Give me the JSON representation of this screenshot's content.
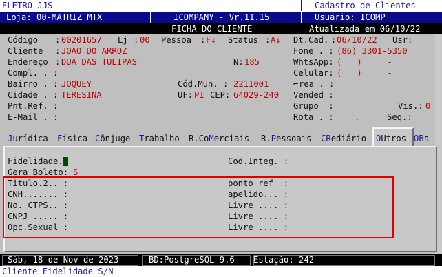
{
  "header": {
    "company": "ELETRO JJS",
    "screen_title": "Cadastro de Clientes",
    "store": "Loja: 00-MATRIZ MTX",
    "system": "ICOMPANY - Vr.11.15",
    "user": "Usuário: ICOMP",
    "form_title": "FICHA DO CLIENTE",
    "updated": "Atualizada em 06/10/22"
  },
  "fields": {
    "codigo_label": "Código",
    "codigo_value": "00201657",
    "lj_label": "Lj",
    "lj_value": "00",
    "pessoa_label": "Pessoa",
    "pessoa_value": "F↓",
    "status_label": "Status",
    "status_value": "A↓",
    "dtcad_label": "Dt.Cad.",
    "dtcad_value": "06/10/22",
    "usr_label": "Usr:",
    "cliente_label": "Cliente",
    "cliente_value": "JOAO DO ARROZ",
    "fone_label": "Fone . :",
    "fone_value": "(86) 3301-5350",
    "endereco_label": "Endereço",
    "endereco_value": "DUA DAS TULIPAS",
    "n_label": "N:",
    "n_value": "185",
    "whats_label": "WhtsApp:",
    "whats_value": "(   )     -",
    "compl_label": "Compl. . :",
    "celular_label": "Celular:",
    "celular_value": "(   )     -",
    "bairro_label": "Bairro . :",
    "bairro_value": "JOQUEY",
    "codmun_label": "Cód.Mun. :",
    "codmun_value": "2211001",
    "area_label": "rea . :",
    "cidade_label": "Cidade . :",
    "cidade_value": "TERESINA",
    "uf_label": "UF:",
    "uf_value": "PI",
    "cep_label": "CEP:",
    "cep_value": "64029-240",
    "vendedor_label": "Vended :",
    "pntref_label": "Pnt.Ref. :",
    "grupo_label": "Grupo  :",
    "vis_label": "Vis.:",
    "vis_value": "0",
    "email_label": "E-Mail . :",
    "rota_label": "Rota . :",
    "rota_value": ".",
    "seq_label": "Seq.:"
  },
  "tabs": [
    {
      "pre": "",
      "hot": "J",
      "post": "urídica"
    },
    {
      "pre": "",
      "hot": "F",
      "post": "ísica"
    },
    {
      "pre": "",
      "hot": "C",
      "post": "ônjuge"
    },
    {
      "pre": "",
      "hot": "T",
      "post": "rabalho"
    },
    {
      "pre": "R.Co",
      "hot": "M",
      "post": "erciais"
    },
    {
      "pre": "R.",
      "hot": "P",
      "post": "essoais"
    },
    {
      "pre": "C",
      "hot": "R",
      "post": "ediário"
    },
    {
      "pre": "",
      "hot": "O",
      "post": "Utros"
    },
    {
      "pre": "",
      "hot": "OB",
      "post": "s"
    }
  ],
  "outros": {
    "fidelidade_label": "Fidelidade.:",
    "codinteg_label": "Cod.Integ. :",
    "gera_boleto_label": "Gera Boleto:",
    "gera_boleto_value": "S",
    "titulo2_label": "Titulo.2.. :",
    "ponto_ref_label": "ponto ref  :",
    "cnh_label": "CNH....... :",
    "apelido_label": "apelido... :",
    "ctps_label": "No. CTPS.. :",
    "livre1_label": "Livre .... :",
    "cnpj_label": "CNPJ ..... :",
    "livre2_label": "Livre .... :",
    "opcsexual_label": "Opc.Sexual :",
    "livre3_label": "Livre .... :"
  },
  "status": {
    "date": "Sáb, 18 de Nov de 2023",
    "db": "BD:PostgreSQL 9.6",
    "station": "Estação: 242"
  },
  "hint": "Cliente Fidelidade S/N",
  "colors": {
    "label": "#1a1aa6",
    "value": "#c00000",
    "highlight": "#e00000",
    "header_bg": "#0a0a8a"
  }
}
